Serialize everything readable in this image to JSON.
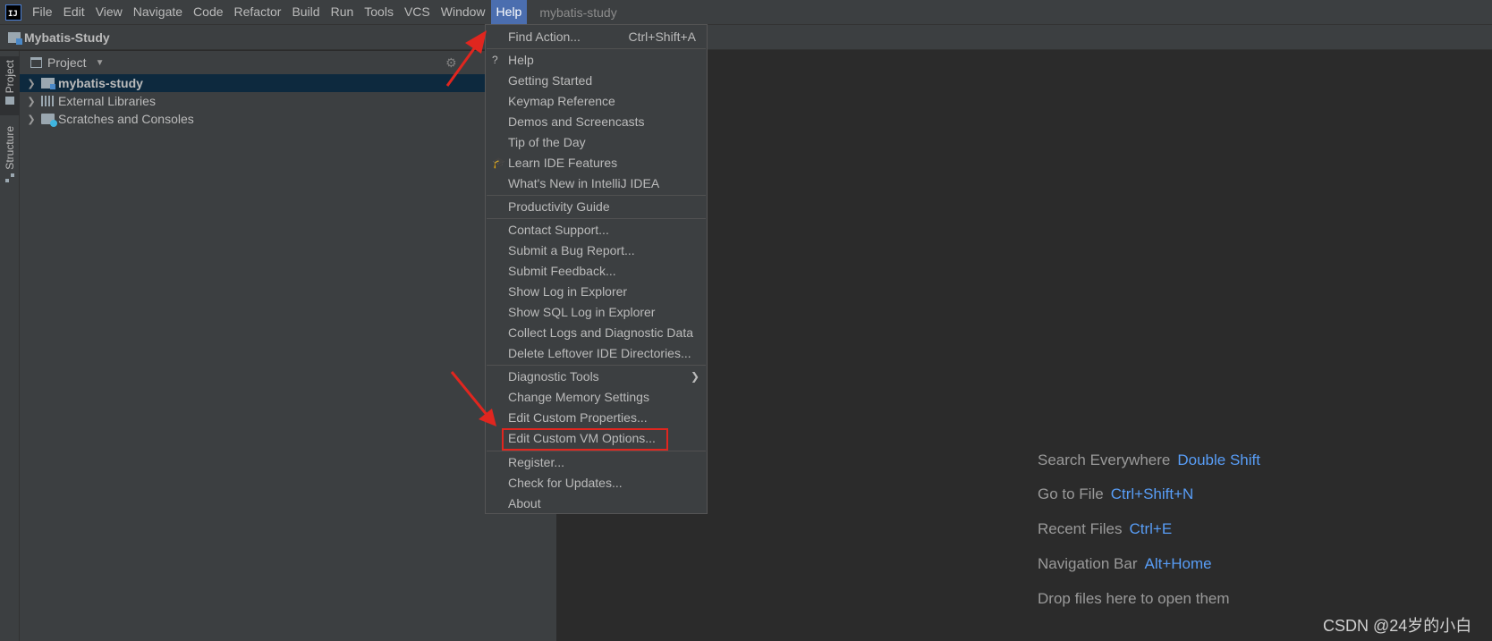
{
  "menubar": {
    "items": [
      "File",
      "Edit",
      "View",
      "Navigate",
      "Code",
      "Refactor",
      "Build",
      "Run",
      "Tools",
      "VCS",
      "Window",
      "Help"
    ],
    "active_item": "Help",
    "window_title": "mybatis-study"
  },
  "navbar": {
    "project_name": "Mybatis-Study"
  },
  "tool_strip": {
    "project_tab": "Project",
    "structure_tab": "Structure"
  },
  "project_panel": {
    "title": "Project",
    "tree": [
      {
        "label": "mybatis-study",
        "icon": "module-folder-icon",
        "selected": true
      },
      {
        "label": "External Libraries",
        "icon": "libraries-icon",
        "selected": false
      },
      {
        "label": "Scratches and Consoles",
        "icon": "scratches-icon",
        "selected": false
      }
    ]
  },
  "help_menu": {
    "find_action": {
      "label": "Find Action...",
      "shortcut": "Ctrl+Shift+A"
    },
    "help": "Help",
    "getting_started": "Getting Started",
    "keymap_reference": "Keymap Reference",
    "demos": "Demos and Screencasts",
    "tip_of_day": "Tip of the Day",
    "learn_ide": "Learn IDE Features",
    "whats_new": "What's New in IntelliJ IDEA",
    "productivity_guide": "Productivity Guide",
    "contact_support": "Contact Support...",
    "submit_bug": "Submit a Bug Report...",
    "submit_feedback": "Submit Feedback...",
    "show_log": "Show Log in Explorer",
    "show_sql_log": "Show SQL Log in Explorer",
    "collect_logs": "Collect Logs and Diagnostic Data",
    "delete_leftover": "Delete Leftover IDE Directories...",
    "diagnostic_tools": "Diagnostic Tools",
    "change_memory": "Change Memory Settings",
    "edit_custom_props": "Edit Custom Properties...",
    "edit_custom_vm": "Edit Custom VM Options...",
    "register": "Register...",
    "check_updates": "Check for Updates...",
    "about": "About"
  },
  "editor_hints": [
    {
      "label": "Search Everywhere",
      "shortcut": "Double Shift"
    },
    {
      "label": "Go to File",
      "shortcut": "Ctrl+Shift+N"
    },
    {
      "label": "Recent Files",
      "shortcut": "Ctrl+E"
    },
    {
      "label": "Navigation Bar",
      "shortcut": "Alt+Home"
    },
    {
      "label": "Drop files here to open them",
      "shortcut": ""
    }
  ],
  "watermark": "CSDN @24岁的小白",
  "colors": {
    "menu_bg": "#3c3f41",
    "editor_bg": "#2b2b2b",
    "active_menu": "#4b6eaf",
    "shortcut_link": "#589df6",
    "annotation_red": "#e0261f",
    "selection": "#0d293e"
  }
}
